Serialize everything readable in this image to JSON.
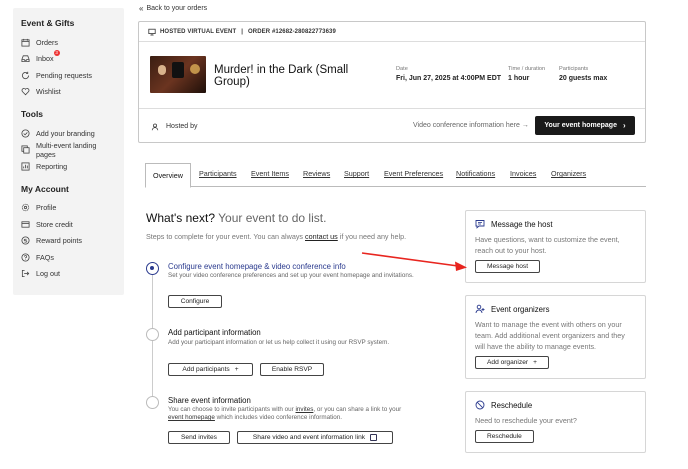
{
  "sidebar": {
    "sections": [
      {
        "title": "Event & Gifts",
        "items": [
          {
            "label": "Orders",
            "icon": "calendar-icon"
          },
          {
            "label": "Inbox",
            "icon": "inbox-icon",
            "badge": "3"
          },
          {
            "label": "Pending requests",
            "icon": "refresh-icon"
          },
          {
            "label": "Wishlist",
            "icon": "heart-icon"
          }
        ]
      },
      {
        "title": "Tools",
        "items": [
          {
            "label": "Add your branding",
            "icon": "check-circle-icon"
          },
          {
            "label": "Multi-event landing pages",
            "icon": "layers-icon"
          },
          {
            "label": "Reporting",
            "icon": "chart-icon"
          }
        ]
      },
      {
        "title": "My Account",
        "items": [
          {
            "label": "Profile",
            "icon": "gear-icon"
          },
          {
            "label": "Store credit",
            "icon": "card-icon"
          },
          {
            "label": "Reward points",
            "icon": "coin-icon"
          },
          {
            "label": "FAQs",
            "icon": "help-icon"
          },
          {
            "label": "Log out",
            "icon": "logout-icon"
          }
        ]
      }
    ]
  },
  "back": {
    "label": "Back to your orders"
  },
  "event": {
    "type_label": "HOSTED VIRTUAL EVENT",
    "order_label": "ORDER #12682-280822773639",
    "title": "Murder! in the Dark (Small Group)",
    "date_label": "Date",
    "date_value": "Fri, Jun 27, 2025 at 4:00PM EDT",
    "duration_label": "Time / duration",
    "duration_value": "1 hour",
    "participants_label": "Participants",
    "participants_value": "20 guests max",
    "hosted_by": "Hosted by",
    "vc_link": "Video conference information here →",
    "homepage_button": "Your event homepage"
  },
  "tabs": [
    "Overview",
    "Participants",
    "Event Items",
    "Reviews",
    "Support",
    "Event Preferences",
    "Notifications",
    "Invoices",
    "Organizers"
  ],
  "whats_next": {
    "title": "What's next?",
    "subtitle": "Your event to do list.",
    "desc_pre": "Steps to complete for your event. You can always ",
    "desc_link": "contact us",
    "desc_post": " if you need any help."
  },
  "steps": [
    {
      "title": "Configure event homepage & video conference info",
      "desc": "Set your video conference preferences and set up your event homepage and invitations.",
      "buttons": [
        "Configure"
      ]
    },
    {
      "title": "Add participant information",
      "desc": "Add your participant information or let us help collect it using our RSVP system.",
      "buttons": [
        "Add participants",
        "Enable RSVP"
      ]
    },
    {
      "title": "Share event information",
      "desc_pre": "You can choose to invite participants with our ",
      "desc_link1": "invites",
      "desc_mid": ", or you can share a link to your ",
      "desc_link2": "event homepage",
      "desc_post": " which includes video conference information.",
      "buttons": [
        "Send invites",
        "Share video and event information link"
      ]
    }
  ],
  "cards": {
    "message": {
      "title": "Message the host",
      "body": "Have questions, want to customize the event, reach out to your host.",
      "button": "Message host"
    },
    "organizers": {
      "title": "Event organizers",
      "body": "Want to manage the event with others on your team. Add additional event organizers and they will have the ability to manage events.",
      "button": "Add organizer"
    },
    "reschedule": {
      "title": "Reschedule",
      "body": "Need to reschedule your event?",
      "button": "Reschedule"
    }
  },
  "colors": {
    "accent": "#2a3a8e",
    "arrow": "#e8251f",
    "dark_button": "#1a1a1a"
  }
}
